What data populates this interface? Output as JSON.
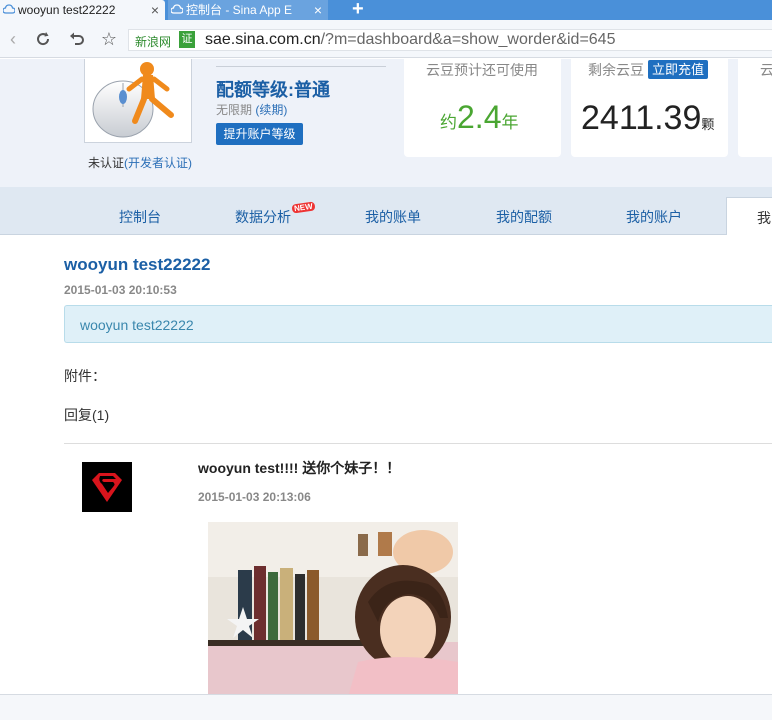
{
  "browser": {
    "tabs": [
      {
        "title": "wooyun test22222",
        "active": true,
        "icon": "cloud-icon"
      },
      {
        "title": "控制台 - Sina App E",
        "active": false,
        "icon": "cloud-icon"
      }
    ],
    "new_tab_label": "+",
    "site_label": "新浪网",
    "cert_badge": "证",
    "url_domain": "sae.sina.com.cn",
    "url_rest": "/?m=dashboard&a=show_worder&id=645"
  },
  "account": {
    "verify_status": "未认证",
    "verify_link": "(开发者认证)",
    "quota_level": "配额等级:普通",
    "unlimited": "无限期",
    "renew_link": "(续期)",
    "upgrade_button": "提升账户等级",
    "card_estimate_label": "云豆预计还可使用",
    "estimate_prefix": "约",
    "estimate_value": "2.4",
    "estimate_unit": "年",
    "card_remaining_label": "剩余云豆",
    "recharge_button": "立即充值",
    "remaining_value": "2411.39",
    "remaining_unit": "颗",
    "card3_label": "云",
    "accent_color": "#1f6fc0",
    "estimate_color": "#4aa632"
  },
  "nav": {
    "items": [
      "控制台",
      "数据分析",
      "我的账单",
      "我的配额",
      "我的账户",
      "我的"
    ],
    "new_badge": "NEW",
    "active_index": 5
  },
  "post": {
    "title": "wooyun test22222",
    "time": "2015-01-03 20:10:53",
    "body": "wooyun test22222",
    "attachments_label": "附件：",
    "replies_label": "回复(1)"
  },
  "reply": {
    "title": "wooyun test!!!!  送你个妹子！！",
    "time": "2015-01-03 20:13:06",
    "avatar_icon": "superman-logo-icon"
  }
}
